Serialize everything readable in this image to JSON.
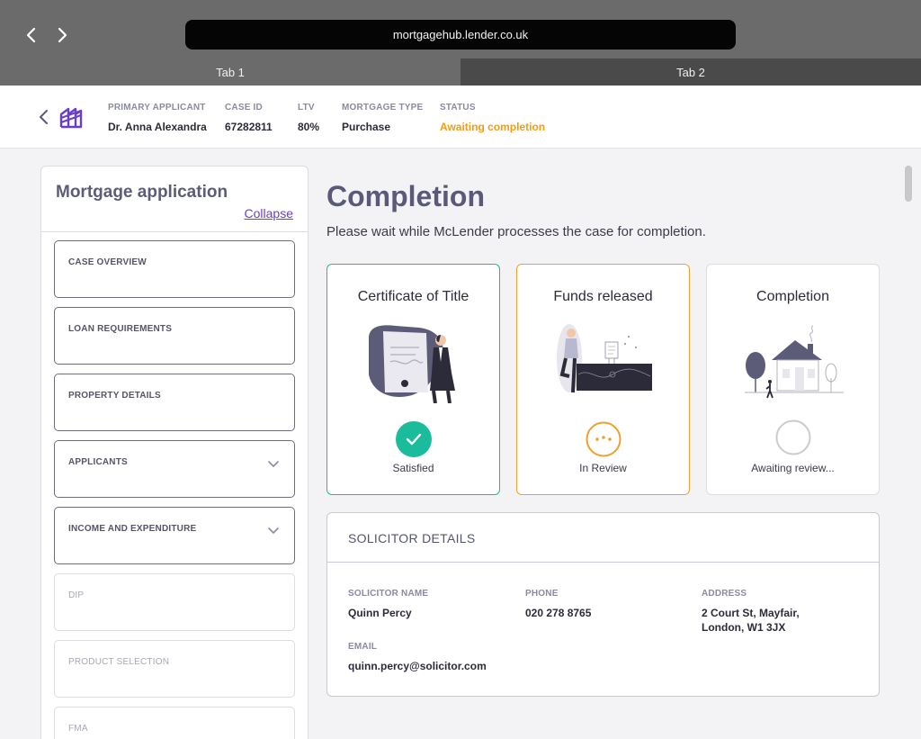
{
  "browser": {
    "url": "mortgagehub.lender.co.uk",
    "tabs": [
      {
        "label": "Tab 1"
      },
      {
        "label": "Tab 2"
      }
    ]
  },
  "header": {
    "primary_applicant": {
      "label": "PRIMARY APPLICANT",
      "value": "Dr. Anna Alexandra"
    },
    "case_id": {
      "label": "CASE ID",
      "value": "67282811"
    },
    "ltv": {
      "label": "LTV",
      "value": "80%"
    },
    "mortgage_type": {
      "label": "MORTGAGE TYPE",
      "value": "Purchase"
    },
    "status": {
      "label": "STATUS",
      "value": "Awaiting completion",
      "color": "#f39c12"
    }
  },
  "sidebar": {
    "title": "Mortgage application",
    "collapse_label": "Collapse",
    "items": [
      {
        "label": "CASE OVERVIEW",
        "enabled": true,
        "expandable": false
      },
      {
        "label": "LOAN REQUIREMENTS",
        "enabled": true,
        "expandable": false
      },
      {
        "label": "PROPERTY DETAILS",
        "enabled": true,
        "expandable": false
      },
      {
        "label": "APPLICANTS",
        "enabled": true,
        "expandable": true
      },
      {
        "label": "INCOME AND EXPENDITURE",
        "enabled": true,
        "expandable": true
      },
      {
        "label": "DIP",
        "enabled": false,
        "expandable": false
      },
      {
        "label": "PRODUCT SELECTION",
        "enabled": false,
        "expandable": false
      },
      {
        "label": "FMA",
        "enabled": false,
        "expandable": false
      }
    ]
  },
  "main": {
    "title": "Completion",
    "subtitle": "Please wait while McLender processes the case for completion.",
    "steps": [
      {
        "title": "Certificate of Title",
        "status": "Satisfied",
        "state": "complete",
        "icon": "check-icon",
        "color": "#1abc9c"
      },
      {
        "title": "Funds released",
        "status": "In Review",
        "state": "in-review",
        "icon": "ellipsis-icon",
        "color": "#f0a030"
      },
      {
        "title": "Completion",
        "status": "Awaiting review...",
        "state": "pending",
        "icon": "empty-circle-icon",
        "color": "#cccccc"
      }
    ],
    "solicitor": {
      "title": "SOLICITOR DETAILS",
      "name": {
        "label": "SOLICITOR NAME",
        "value": "Quinn Percy"
      },
      "phone": {
        "label": "PHONE",
        "value": "020 278 8765"
      },
      "address": {
        "label": "ADDRESS",
        "line1": "2 Court St, Mayfair,",
        "line2": "London, W1 3JX"
      },
      "email": {
        "label": "EMAIL",
        "value": "quinn.percy@solicitor.com"
      }
    }
  }
}
